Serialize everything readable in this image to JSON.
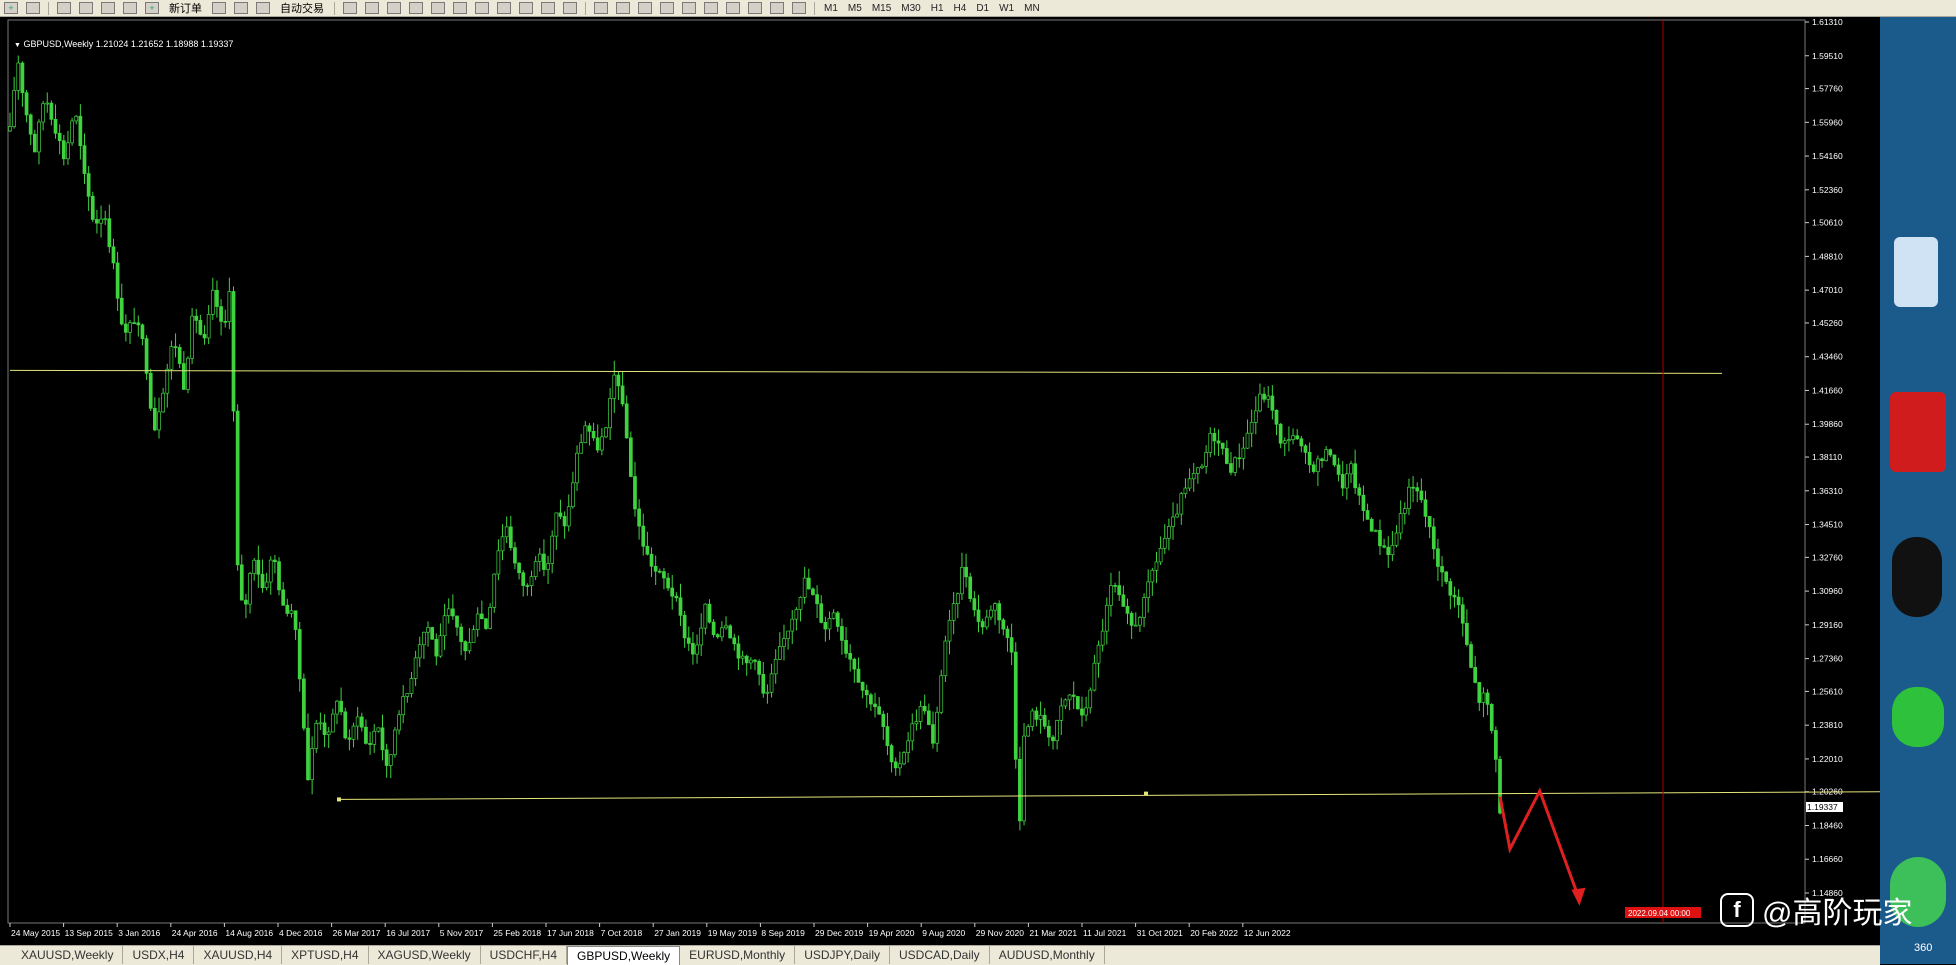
{
  "toolbar": {
    "new_order_label": "新订单",
    "auto_trade_label": "自动交易",
    "timeframes": [
      "M1",
      "M5",
      "M15",
      "M30",
      "H1",
      "H4",
      "D1",
      "W1",
      "MN"
    ]
  },
  "chart": {
    "header": "GBPUSD,Weekly  1.21024 1.21652 1.18988 1.19337",
    "current_price_label": "1.19337",
    "cursor_date_label": "2022.09.04 00:00"
  },
  "chart_data": {
    "type": "candlestick",
    "symbol": "GBPUSD",
    "timeframe": "Weekly",
    "ohlc_last": {
      "open": 1.21024,
      "high": 1.21652,
      "low": 1.18988,
      "close": 1.19337
    },
    "ylim": [
      1.1358,
      1.6131
    ],
    "y_ticks": [
      "1.61310",
      "1.59510",
      "1.57760",
      "1.55960",
      "1.54160",
      "1.52360",
      "1.50610",
      "1.48810",
      "1.47010",
      "1.45260",
      "1.43460",
      "1.41660",
      "1.39860",
      "1.38110",
      "1.36310",
      "1.34510",
      "1.32760",
      "1.30960",
      "1.29160",
      "1.27360",
      "1.25610",
      "1.23810",
      "1.22010",
      "1.20260",
      "1.18460",
      "1.16660",
      "1.14860"
    ],
    "x_ticks": [
      "24 May 2015",
      "13 Sep 2015",
      "3 Jan 2016",
      "24 Apr 2016",
      "14 Aug 2016",
      "4 Dec 2016",
      "26 Mar 2017",
      "16 Jul 2017",
      "5 Nov 2017",
      "25 Feb 2018",
      "17 Jun 2018",
      "7 Oct 2018",
      "27 Jan 2019",
      "19 May 2019",
      "8 Sep 2019",
      "29 Dec 2019",
      "19 Apr 2020",
      "9 Aug 2020",
      "29 Nov 2020",
      "21 Mar 2021",
      "11 Jul 2021",
      "31 Oct 2021",
      "20 Feb 2022",
      "12 Jun 2022"
    ],
    "price_path": [
      [
        0,
        1.555
      ],
      [
        1.5,
        1.595
      ],
      [
        3,
        1.568
      ],
      [
        5,
        1.545
      ],
      [
        7,
        1.575
      ],
      [
        9,
        1.558
      ],
      [
        11,
        1.54
      ],
      [
        13,
        1.568
      ],
      [
        15,
        1.53
      ],
      [
        17,
        1.505
      ],
      [
        19,
        1.512
      ],
      [
        21,
        1.48
      ],
      [
        23,
        1.445
      ],
      [
        25,
        1.455
      ],
      [
        27,
        1.44
      ],
      [
        29,
        1.395
      ],
      [
        31,
        1.42
      ],
      [
        33,
        1.445
      ],
      [
        35,
        1.42
      ],
      [
        37,
        1.46
      ],
      [
        39,
        1.44
      ],
      [
        41,
        1.47
      ],
      [
        43,
        1.445
      ],
      [
        44.5,
        1.48
      ],
      [
        45.5,
        1.33
      ],
      [
        47,
        1.295
      ],
      [
        49,
        1.33
      ],
      [
        51,
        1.31
      ],
      [
        53,
        1.33
      ],
      [
        55,
        1.3
      ],
      [
        57,
        1.3
      ],
      [
        59,
        1.245
      ],
      [
        60,
        1.21
      ],
      [
        62,
        1.245
      ],
      [
        64,
        1.23
      ],
      [
        66,
        1.255
      ],
      [
        68,
        1.225
      ],
      [
        70,
        1.245
      ],
      [
        72,
        1.225
      ],
      [
        74,
        1.24
      ],
      [
        76,
        1.212
      ],
      [
        78,
        1.245
      ],
      [
        80,
        1.255
      ],
      [
        82,
        1.28
      ],
      [
        84,
        1.292
      ],
      [
        86,
        1.275
      ],
      [
        88,
        1.3
      ],
      [
        90,
        1.29
      ],
      [
        92,
        1.275
      ],
      [
        94,
        1.3
      ],
      [
        96,
        1.29
      ],
      [
        98,
        1.33
      ],
      [
        100,
        1.345
      ],
      [
        102,
        1.32
      ],
      [
        104,
        1.31
      ],
      [
        106,
        1.33
      ],
      [
        108,
        1.32
      ],
      [
        110,
        1.35
      ],
      [
        112,
        1.345
      ],
      [
        114,
        1.38
      ],
      [
        116,
        1.4
      ],
      [
        118,
        1.385
      ],
      [
        120,
        1.395
      ],
      [
        122,
        1.43
      ],
      [
        124,
        1.395
      ],
      [
        126,
        1.35
      ],
      [
        128,
        1.33
      ],
      [
        130,
        1.32
      ],
      [
        132,
        1.315
      ],
      [
        134,
        1.305
      ],
      [
        136,
        1.285
      ],
      [
        138,
        1.275
      ],
      [
        140,
        1.3
      ],
      [
        142,
        1.285
      ],
      [
        144,
        1.295
      ],
      [
        146,
        1.28
      ],
      [
        148,
        1.27
      ],
      [
        150,
        1.275
      ],
      [
        152,
        1.25
      ],
      [
        154,
        1.27
      ],
      [
        156,
        1.285
      ],
      [
        158,
        1.3
      ],
      [
        160,
        1.315
      ],
      [
        162,
        1.305
      ],
      [
        164,
        1.29
      ],
      [
        166,
        1.3
      ],
      [
        168,
        1.28
      ],
      [
        170,
        1.27
      ],
      [
        172,
        1.255
      ],
      [
        174,
        1.25
      ],
      [
        176,
        1.235
      ],
      [
        178,
        1.21
      ],
      [
        180,
        1.225
      ],
      [
        182,
        1.24
      ],
      [
        184,
        1.25
      ],
      [
        186,
        1.225
      ],
      [
        188,
        1.28
      ],
      [
        190,
        1.3
      ],
      [
        192,
        1.325
      ],
      [
        194,
        1.3
      ],
      [
        196,
        1.29
      ],
      [
        198,
        1.305
      ],
      [
        200,
        1.29
      ],
      [
        202,
        1.275
      ],
      [
        203,
        1.17
      ],
      [
        204,
        1.23
      ],
      [
        206,
        1.245
      ],
      [
        208,
        1.24
      ],
      [
        210,
        1.23
      ],
      [
        212,
        1.25
      ],
      [
        214,
        1.255
      ],
      [
        216,
        1.24
      ],
      [
        218,
        1.265
      ],
      [
        220,
        1.29
      ],
      [
        222,
        1.315
      ],
      [
        224,
        1.3
      ],
      [
        226,
        1.29
      ],
      [
        228,
        1.3
      ],
      [
        230,
        1.32
      ],
      [
        232,
        1.335
      ],
      [
        234,
        1.345
      ],
      [
        236,
        1.36
      ],
      [
        238,
        1.37
      ],
      [
        240,
        1.375
      ],
      [
        242,
        1.395
      ],
      [
        244,
        1.385
      ],
      [
        246,
        1.375
      ],
      [
        248,
        1.385
      ],
      [
        250,
        1.4
      ],
      [
        252,
        1.415
      ],
      [
        254,
        1.41
      ],
      [
        256,
        1.385
      ],
      [
        258,
        1.395
      ],
      [
        260,
        1.385
      ],
      [
        262,
        1.375
      ],
      [
        264,
        1.38
      ],
      [
        266,
        1.385
      ],
      [
        268,
        1.365
      ],
      [
        270,
        1.375
      ],
      [
        272,
        1.355
      ],
      [
        274,
        1.345
      ],
      [
        276,
        1.335
      ],
      [
        278,
        1.33
      ],
      [
        280,
        1.35
      ],
      [
        282,
        1.365
      ],
      [
        284,
        1.36
      ],
      [
        286,
        1.34
      ],
      [
        288,
        1.32
      ],
      [
        290,
        1.31
      ],
      [
        292,
        1.3
      ],
      [
        294,
        1.27
      ],
      [
        296,
        1.25
      ],
      [
        297,
        1.255
      ],
      [
        299,
        1.225
      ],
      [
        300,
        1.19337
      ]
    ],
    "lines": [
      {
        "kind": "resistance",
        "y": 1.4273
      },
      {
        "kind": "support",
        "y_start": 1.1985,
        "y_end": 1.2026
      }
    ],
    "projection": {
      "color": "#e02020",
      "points": [
        [
          300,
          1.2
        ],
        [
          302,
          1.172
        ],
        [
          308,
          1.203
        ],
        [
          316,
          1.145
        ]
      ]
    },
    "grid": false
  },
  "tabs": [
    {
      "label": "XAUUSD,Weekly"
    },
    {
      "label": "USDX,H4"
    },
    {
      "label": "XAUUSD,H4"
    },
    {
      "label": "XPTUSD,H4"
    },
    {
      "label": "XAGUSD,Weekly"
    },
    {
      "label": "USDCHF,H4"
    },
    {
      "label": "GBPUSD,Weekly",
      "active": true
    },
    {
      "label": "EURUSD,Monthly"
    },
    {
      "label": "USDJPY,Daily"
    },
    {
      "label": "USDCAD,Daily"
    },
    {
      "label": "AUDUSD,Monthly"
    }
  ],
  "watermark": {
    "text": "@高阶玩家"
  },
  "desktop": {
    "side_label": "360"
  },
  "colors": {
    "candles": "#3fd33f",
    "lines": "#e4e47a",
    "projection": "#e02020",
    "background": "#000000",
    "axis": "#ffffff"
  }
}
